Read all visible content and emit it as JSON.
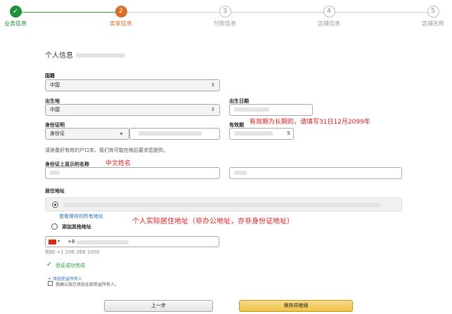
{
  "stepper": {
    "steps": [
      {
        "number": "✓",
        "label": "业务信息"
      },
      {
        "number": "2",
        "label": "卖家信息"
      },
      {
        "number": "3",
        "label": "付款信息"
      },
      {
        "number": "4",
        "label": "店铺信息"
      },
      {
        "number": "5",
        "label": "店铺名称"
      }
    ]
  },
  "section": {
    "title": "个人信息"
  },
  "nationality": {
    "label": "国籍",
    "value": "中国"
  },
  "birthplace": {
    "label": "出生地",
    "value": "中国"
  },
  "birthdate": {
    "label": "出生日期"
  },
  "id_proof": {
    "label": "身份证明",
    "type_value": "身份证"
  },
  "expiry": {
    "label": "有效期",
    "value_suffix": "5"
  },
  "annotations": {
    "expiry_note": "有效期为长期的，请填写31日12月2099年",
    "chinese_name": "中文姓名",
    "address_note": "个人实际居住地址（非办公地址，亦非身份证地址）"
  },
  "id_note": "请准备好有效的户口本，我们有可能在稍后要求您提供。",
  "name_on_id": {
    "label": "身份证上显示的名称"
  },
  "residence": {
    "label": "居住地址",
    "view_all_link": "查看保存的所有地址",
    "add_other": "添加其他地址"
  },
  "phone": {
    "prefix": "+8",
    "example": "例如 +1 206 266 1000"
  },
  "verify": {
    "text": "验证成功完成"
  },
  "beneficiary": {
    "link": "+ 添加受益所有人",
    "checkbox_text": "我确认我已添加全部受益所有人。"
  },
  "buttons": {
    "prev": "上一步",
    "next": "保存并继续"
  },
  "colors": {
    "done": "#1f8f3a",
    "active": "#d9702a",
    "annotation": "#e01a1a",
    "primary_button": "#efc24a"
  }
}
